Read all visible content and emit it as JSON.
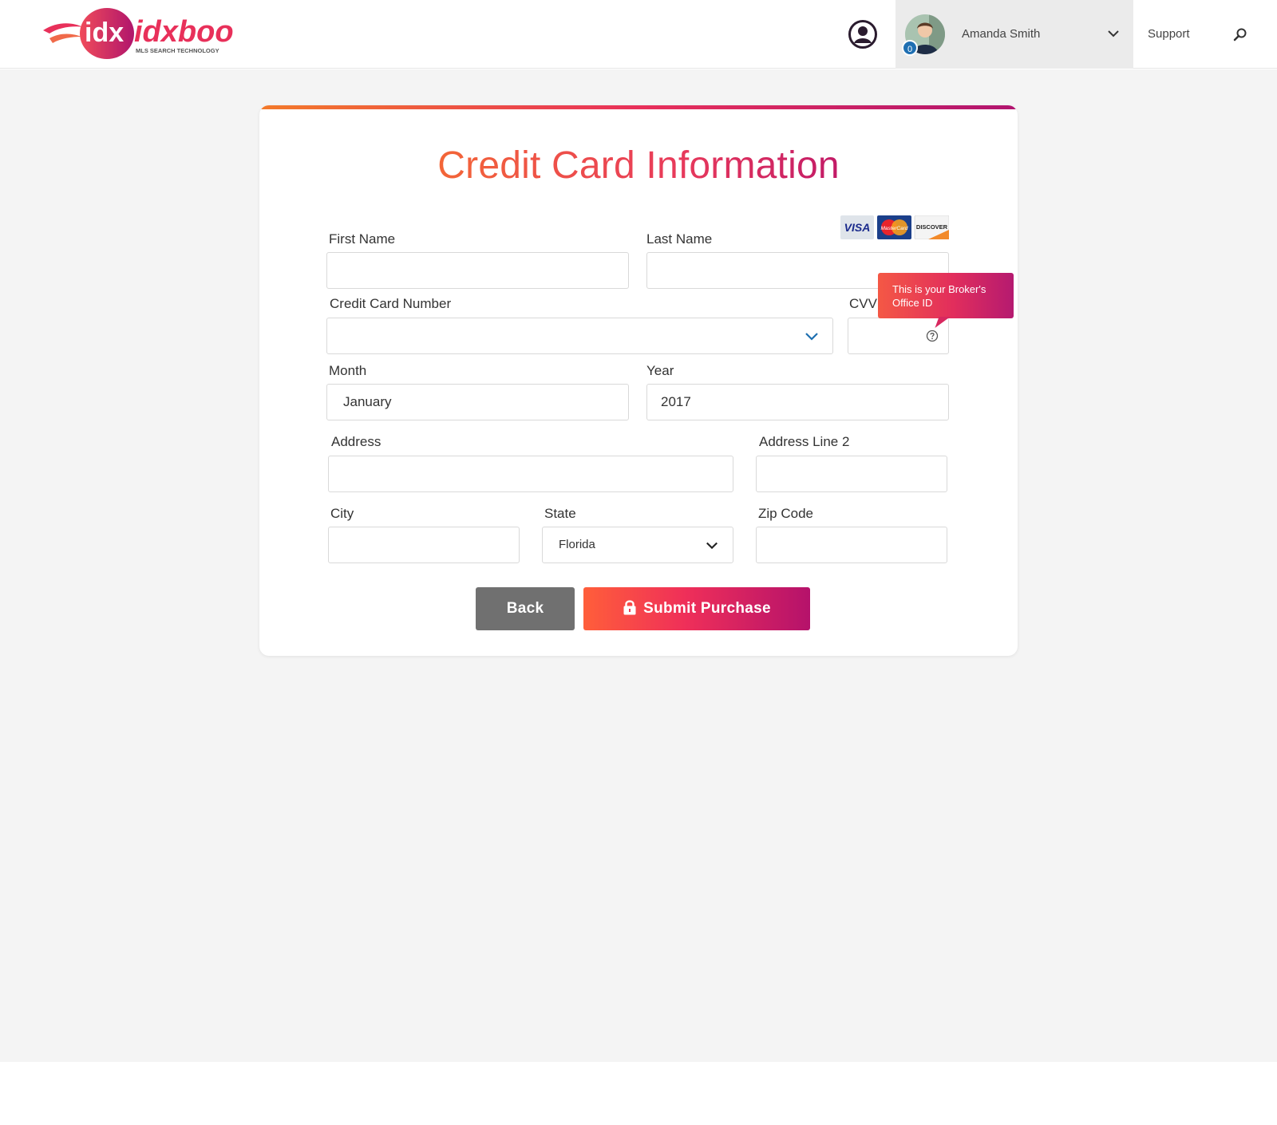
{
  "header": {
    "logo_text": "idxboost",
    "logo_tagline": "MLS SEARCH TECHNOLOGY",
    "user_name": "Amanda Smith",
    "notification_count": "0",
    "support_label": "Support"
  },
  "form": {
    "title": "Credit Card Information",
    "first_name_label": "First Name",
    "last_name_label": "Last Name",
    "card_number_label": "Credit Card Number",
    "cvv_label": "CVV",
    "month_label": "Month",
    "month_value": "January",
    "year_label": "Year",
    "year_value": "2017",
    "address_label": "Address",
    "address2_label": "Address Line 2",
    "city_label": "City",
    "state_label": "State",
    "state_value": "Florida",
    "zip_label": "Zip Code",
    "tooltip_text": "This is your Broker's Office ID",
    "card_brands": [
      "VISA",
      "MasterCard",
      "DISCOVER"
    ]
  },
  "buttons": {
    "back_label": "Back",
    "submit_label": "Submit Purchase"
  },
  "colors": {
    "accent_orange": "#f36637",
    "accent_pink": "#e8305a",
    "accent_purple": "#b1146f",
    "page_bg": "#f4f4f4",
    "back_button": "#707070"
  }
}
